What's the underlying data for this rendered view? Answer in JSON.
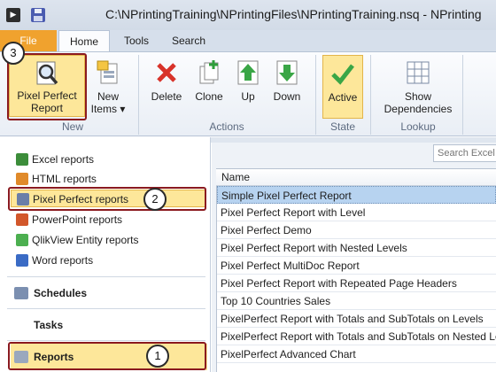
{
  "window": {
    "title": "C:\\NPrintingTraining\\NPrintingFiles\\NPrintingTraining.nsq - NPrinting"
  },
  "tabs": {
    "file": "File",
    "home": "Home",
    "tools": "Tools",
    "search": "Search"
  },
  "ribbon": {
    "pixel_perfect_report": "Pixel Perfect Report",
    "new_items": "New Items",
    "new_items_caret": "▾",
    "group_new": "New",
    "delete": "Delete",
    "clone": "Clone",
    "up": "Up",
    "down": "Down",
    "group_actions": "Actions",
    "active": "Active",
    "group_state": "State",
    "show_dependencies": "Show Dependencies",
    "group_lookup": "Lookup"
  },
  "nav": {
    "reports_items": [
      {
        "label": "Excel reports",
        "icon": "excel-reports-icon",
        "color": "#3c8d3a"
      },
      {
        "label": "HTML reports",
        "icon": "html-reports-icon",
        "color": "#e08a2a"
      },
      {
        "label": "Pixel Perfect reports",
        "icon": "pixel-perfect-reports-icon",
        "color": "#6b7ea8"
      },
      {
        "label": "PowerPoint reports",
        "icon": "powerpoint-reports-icon",
        "color": "#d2572b"
      },
      {
        "label": "QlikView Entity reports",
        "icon": "qlikview-entity-reports-icon",
        "color": "#4caf50"
      },
      {
        "label": "Word reports",
        "icon": "word-reports-icon",
        "color": "#3a6bc5"
      }
    ],
    "sections": [
      {
        "label": "Schedules",
        "icon": "schedules-icon"
      },
      {
        "label": "Tasks",
        "icon": "tasks-icon"
      },
      {
        "label": "Reports",
        "icon": "reports-icon"
      }
    ]
  },
  "list": {
    "search_placeholder": "Search Excel",
    "column_name": "Name",
    "rows": [
      "Simple Pixel Perfect Report",
      "Pixel Perfect Report with Level",
      "Pixel Perfect Demo",
      "Pixel Perfect Report with Nested Levels",
      "Pixel Perfect MultiDoc Report",
      "Pixel Perfect Report with Repeated Page Headers",
      "Top 10 Countries Sales",
      "PixelPerfect Report with Totals and SubTotals on Levels",
      "PixelPerfect Report with Totals and SubTotals on Nested Levels",
      "PixelPerfect Advanced Chart"
    ]
  },
  "callouts": {
    "one": "1",
    "two": "2",
    "three": "3"
  },
  "colors": {
    "accent": "#f0a22e",
    "callout": "#8b1a1f",
    "selection": "#fde79a"
  }
}
